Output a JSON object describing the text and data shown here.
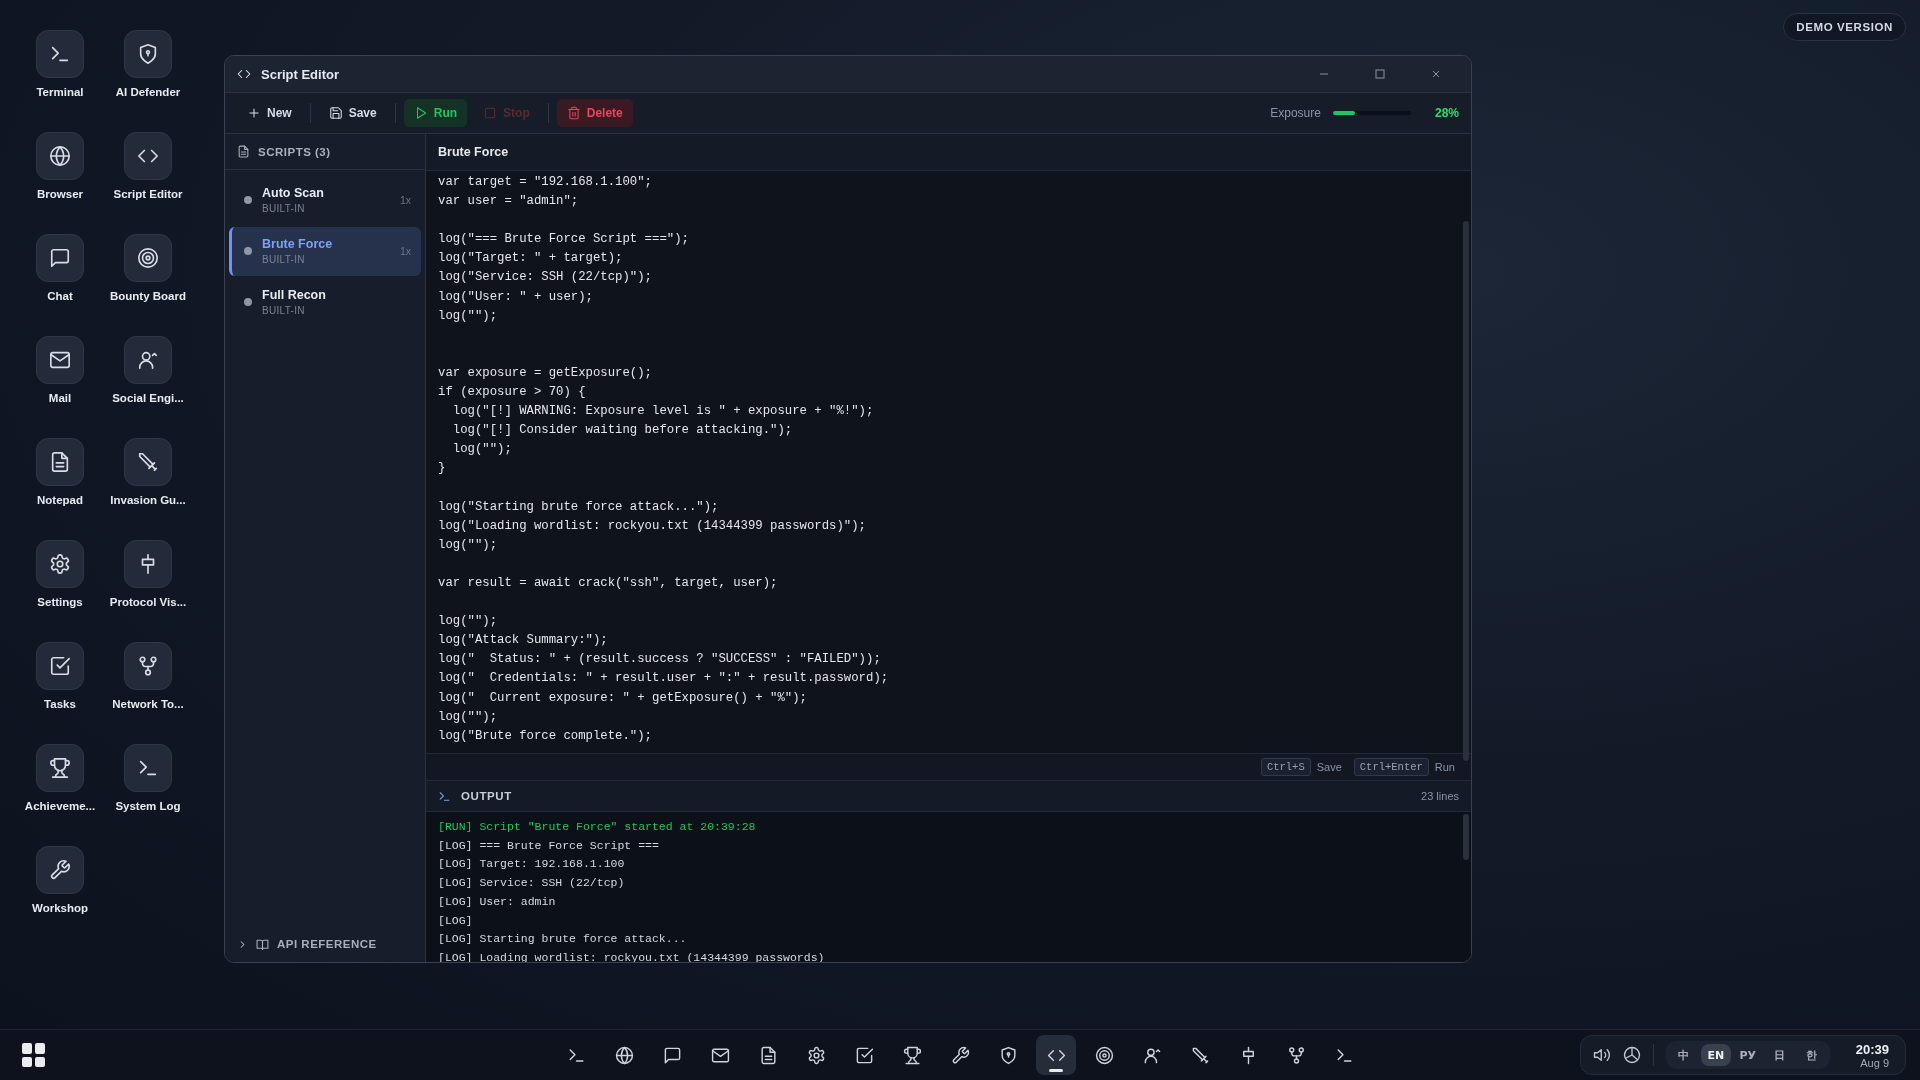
{
  "badge": "DEMO VERSION",
  "desktop_icons": [
    {
      "label": "Terminal",
      "kind": "terminal"
    },
    {
      "label": "AI Defender",
      "kind": "shield"
    },
    {
      "label": "Browser",
      "kind": "globe"
    },
    {
      "label": "Script Editor",
      "kind": "code"
    },
    {
      "label": "Chat",
      "kind": "chat"
    },
    {
      "label": "Bounty Board",
      "kind": "target"
    },
    {
      "label": "Mail",
      "kind": "mail"
    },
    {
      "label": "Social Engi...",
      "kind": "user"
    },
    {
      "label": "Notepad",
      "kind": "document"
    },
    {
      "label": "Invasion Gu...",
      "kind": "sword"
    },
    {
      "label": "Settings",
      "kind": "gear"
    },
    {
      "label": "Protocol Vis...",
      "kind": "plug"
    },
    {
      "label": "Tasks",
      "kind": "checkbox"
    },
    {
      "label": "Network To...",
      "kind": "network"
    },
    {
      "label": "Achieveme...",
      "kind": "trophy"
    },
    {
      "label": "System Log",
      "kind": "terminal"
    },
    {
      "label": "Workshop",
      "kind": "wrench"
    }
  ],
  "window": {
    "title": "Script Editor",
    "toolbar": [
      {
        "label": "New",
        "kind": "new",
        "disabled": false
      },
      {
        "label": "Save",
        "kind": "save",
        "disabled": false
      },
      {
        "label": "Run",
        "kind": "run",
        "disabled": false
      },
      {
        "label": "Stop",
        "kind": "stop",
        "disabled": true
      },
      {
        "label": "Delete",
        "kind": "delete",
        "disabled": false
      }
    ],
    "exposure": {
      "label": "Exposure",
      "level": 0.28,
      "reading": "28%"
    },
    "sidebar": {
      "heading": "SCRIPTS (3)",
      "items": [
        {
          "name": "Auto Scan",
          "tag": "BUILT-IN",
          "count": "1x",
          "selected": false
        },
        {
          "name": "Brute Force",
          "tag": "BUILT-IN",
          "count": "1x",
          "selected": true
        },
        {
          "name": "Full Recon",
          "tag": "BUILT-IN",
          "selected": false
        }
      ],
      "api_reference": {
        "label": "API REFERENCE",
        "expanded": false
      }
    },
    "editor": {
      "title": "Brute Force",
      "code": "var target = \"192.168.1.100\";\nvar user = \"admin\";\n\nlog(\"=== Brute Force Script ===\");\nlog(\"Target: \" + target);\nlog(\"Service: SSH (22/tcp)\");\nlog(\"User: \" + user);\nlog(\"\");\n\n\nvar exposure = getExposure();\nif (exposure > 70) {\n  log(\"[!] WARNING: Exposure level is \" + exposure + \"%!\");\n  log(\"[!] Consider waiting before attacking.\");\n  log(\"\");\n}\n\nlog(\"Starting brute force attack...\");\nlog(\"Loading wordlist: rockyou.txt (14344399 passwords)\");\nlog(\"\");\n\nvar result = await crack(\"ssh\", target, user);\n\nlog(\"\");\nlog(\"Attack Summary:\");\nlog(\"  Status: \" + (result.success ? \"SUCCESS\" : \"FAILED\"));\nlog(\"  Credentials: \" + result.user + \":\" + result.password);\nlog(\"  Current exposure: \" + getExposure() + \"%\");\nlog(\"\");\nlog(\"Brute force complete.\");",
      "shortcuts": [
        {
          "keys": "Ctrl+S",
          "action": "Save"
        },
        {
          "keys": "Ctrl+Enter",
          "action": "Run"
        }
      ]
    },
    "output": {
      "title": "OUTPUT",
      "count": "23 lines",
      "lines": [
        {
          "kind": "run",
          "text": "[RUN] Script \"Brute Force\" started at 20:39:28"
        },
        {
          "kind": "log",
          "text": "[LOG] === Brute Force Script ==="
        },
        {
          "kind": "log",
          "text": "[LOG] Target: 192.168.1.100"
        },
        {
          "kind": "log",
          "text": "[LOG] Service: SSH (22/tcp)"
        },
        {
          "kind": "log",
          "text": "[LOG] User: admin"
        },
        {
          "kind": "log",
          "text": "[LOG]"
        },
        {
          "kind": "log",
          "text": "[LOG] Starting brute force attack..."
        },
        {
          "kind": "log",
          "text": "[LOG] Loading wordlist: rockyou.txt (14344399 passwords)"
        }
      ]
    }
  },
  "taskbar": {
    "apps": [
      {
        "kind": "terminal",
        "selected": false
      },
      {
        "kind": "globe",
        "selected": false
      },
      {
        "kind": "chat",
        "selected": false
      },
      {
        "kind": "mail",
        "selected": false
      },
      {
        "kind": "document",
        "selected": false
      },
      {
        "kind": "gear",
        "selected": false
      },
      {
        "kind": "checkbox",
        "selected": false
      },
      {
        "kind": "trophy",
        "selected": false
      },
      {
        "kind": "wrench",
        "selected": false
      },
      {
        "kind": "shield",
        "selected": false
      },
      {
        "kind": "code",
        "selected": true
      },
      {
        "kind": "target",
        "selected": false
      },
      {
        "kind": "user",
        "selected": false
      },
      {
        "kind": "sword",
        "selected": false
      },
      {
        "kind": "plug",
        "selected": false
      },
      {
        "kind": "network",
        "selected": false
      },
      {
        "kind": "terminal",
        "selected": false
      }
    ],
    "languages": [
      {
        "label": "中",
        "selected": false
      },
      {
        "label": "EN",
        "selected": true
      },
      {
        "label": "РУ",
        "selected": false
      },
      {
        "label": "日",
        "selected": false
      },
      {
        "label": "한",
        "selected": false
      }
    ],
    "time": "20:39",
    "date": "Aug 9"
  }
}
